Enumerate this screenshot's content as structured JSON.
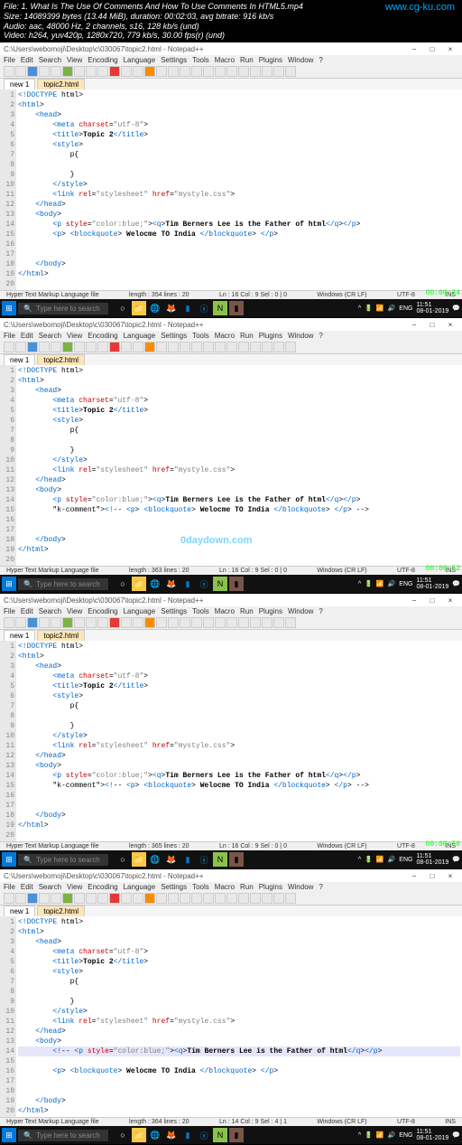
{
  "header": {
    "file": "File: 1. What Is The Use Of Comments And How To Use Comments In HTML5.mp4",
    "size": "Size: 14089399 bytes (13.44 MiB), duration: 00:02:03, avg bitrate: 916 kb/s",
    "audio": "Audio: aac, 48000 Hz, 2 channels, s16, 128 kb/s (und)",
    "video": "Video: h264, yuv420p, 1280x720, 779 kb/s, 30.00 fps(r) (und)",
    "brand": "www.cg-ku.com"
  },
  "app_title": "C:\\Users\\webomoji\\Desktop\\c\\030067\\topic2.html - Notepad++",
  "menu": [
    "File",
    "Edit",
    "Search",
    "View",
    "Encoding",
    "Language",
    "Settings",
    "Tools",
    "Macro",
    "Run",
    "Plugins",
    "Window",
    "?"
  ],
  "tabs": [
    {
      "label": "new 1"
    },
    {
      "label": "topic2.html",
      "active": true
    }
  ],
  "code": {
    "lines": [
      "<!DOCTYPE html>",
      "<html>",
      "    <head>",
      "        <meta charset=\"utf-8\">",
      "        <title>Topic 2</title>",
      "        <style>",
      "            p{",
      "",
      "            }",
      "        </style>",
      "        <link rel=\"stylesheet\" href=\"mystyle.css\">",
      "    </head>",
      "    <body>",
      "        <p style=\"color:blue;\"><q>Tim Berners Lee is the Father of html</q></p>",
      "        <p> <blockquote> Welocme TO India </blockquote> </p>",
      "",
      "",
      "    </body>",
      "</html>"
    ],
    "panel1_hl": 15,
    "panel1_extra_line": ""
  },
  "statusbar": {
    "lang": "Hyper Text Markup Language file",
    "p1": {
      "length": "length : 354   lines : 20",
      "pos": "Ln : 16   Col : 9   Sel : 0 | 0",
      "eol": "Windows (CR LF)",
      "enc": "UTF-8",
      "mode": "INS"
    },
    "p2": {
      "length": "length : 363   lines : 20",
      "pos": "Ln : 16   Col : 9   Sel : 0 | 0",
      "eol": "Windows (CR LF)",
      "enc": "UTF-8",
      "mode": "INS"
    },
    "p3": {
      "length": "length : 365   lines : 20",
      "pos": "Ln : 16   Col : 9   Sel : 0 | 0",
      "eol": "Windows (CR LF)",
      "enc": "UTF-8",
      "mode": "INS"
    },
    "p4": {
      "length": "length : 364   lines : 20",
      "pos": "Ln : 14   Col : 9   Sel : 4 | 1",
      "eol": "Windows (CR LF)",
      "enc": "UTF-8",
      "mode": "INS"
    }
  },
  "taskbar": {
    "search_placeholder": "Type here to search",
    "time": "11:51",
    "date": "08-01-2019",
    "lang": "ENG"
  },
  "timestamps": [
    "00:00:24",
    "00:00:52",
    "00:00:50"
  ],
  "watermarks": {
    "cg": "cg-ku",
    "dd": "0daydown.com"
  }
}
